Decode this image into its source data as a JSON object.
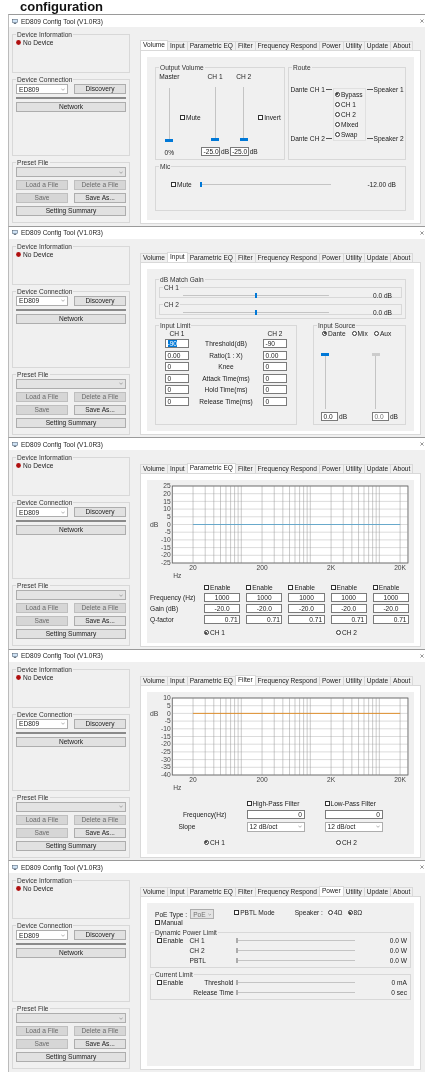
{
  "heading": "configuration",
  "windows": [
    {
      "title": "ED809 Config Tool (V1.0R3)",
      "sidebar": {
        "info_title": "Device Information",
        "status": "No Device",
        "connection_title": "Device Connection",
        "device": "ED809",
        "discovery": "Discovery",
        "network": "Network",
        "preset_title": "Preset File",
        "file_buttons": [
          {
            "label": "Load a File",
            "disabled": true
          },
          {
            "label": "Delete a File",
            "disabled": true
          },
          {
            "label": "Save",
            "disabled": true
          },
          {
            "label": "Save As...",
            "disabled": false
          }
        ],
        "summary": "Setting Summary"
      },
      "tabs": [
        {
          "label": "Volume",
          "selected": true
        },
        {
          "label": "Input",
          "selected": false
        },
        {
          "label": "Parametric EQ",
          "selected": false
        },
        {
          "label": "Filter",
          "selected": false
        },
        {
          "label": "Frequency Respond",
          "selected": false
        },
        {
          "label": "Power",
          "selected": false
        },
        {
          "label": "Utility",
          "selected": false
        },
        {
          "label": "Update",
          "selected": false
        },
        {
          "label": "About",
          "selected": false
        }
      ],
      "content": {
        "kind": "volume",
        "output_title": "Output Volume",
        "columns": [
          {
            "label": "Master",
            "level": 0,
            "reading": "0%"
          },
          {
            "label": "CH 1",
            "level": 0,
            "value": "-25.0",
            "unit": "dB"
          },
          {
            "label": "CH 2",
            "level": 0,
            "value": "-25.0",
            "unit": "dB"
          }
        ],
        "mute": {
          "label": "Mute",
          "checked": false
        },
        "invert": {
          "label": "Invert",
          "checked": false
        },
        "route_title": "Route",
        "route_inputs": [
          "Dante CH 1",
          "Dante CH 2"
        ],
        "route_outputs": [
          "Speaker 1",
          "Speaker 2"
        ],
        "route_options": [
          {
            "label": "Bypass",
            "selected": true
          },
          {
            "label": "CH 1",
            "selected": false
          },
          {
            "label": "CH 2",
            "selected": false
          },
          {
            "label": "Mixed",
            "selected": false
          },
          {
            "label": "Swap",
            "selected": false
          }
        ],
        "mic_title": "Mic",
        "mic_mute": {
          "label": "Mute",
          "checked": false
        },
        "mic_slider": {
          "level": 0
        },
        "mic_reading": "-12.00 dB"
      }
    },
    {
      "title": "ED809 Config Tool (V1.0R3)",
      "sidebar": {
        "info_title": "Device Information",
        "status": "No Device",
        "connection_title": "Device Connection",
        "device": "ED809",
        "discovery": "Discovery",
        "network": "Network",
        "preset_title": "Preset File",
        "file_buttons": [
          {
            "label": "Load a File",
            "disabled": true
          },
          {
            "label": "Delete a File",
            "disabled": true
          },
          {
            "label": "Save",
            "disabled": true
          },
          {
            "label": "Save As...",
            "disabled": false
          }
        ],
        "summary": "Setting Summary"
      },
      "tabs": [
        {
          "label": "Volume",
          "selected": false
        },
        {
          "label": "Input",
          "selected": true
        },
        {
          "label": "Parametric EQ",
          "selected": false
        },
        {
          "label": "Filter",
          "selected": false
        },
        {
          "label": "Frequency Respond",
          "selected": false
        },
        {
          "label": "Power",
          "selected": false
        },
        {
          "label": "Utility",
          "selected": false
        },
        {
          "label": "Update",
          "selected": false
        },
        {
          "label": "About",
          "selected": false
        }
      ],
      "content": {
        "kind": "input",
        "gain_title": "dB Match Gain",
        "gains": [
          {
            "label": "CH 1",
            "level": 0.5,
            "reading": "0.0 dB"
          },
          {
            "label": "CH 2",
            "level": 0.5,
            "reading": "0.0 dB"
          }
        ],
        "limit_title": "Input Limit",
        "limit_headers": [
          "CH 1",
          "CH 2"
        ],
        "limit_rows": [
          {
            "ch1": "-90",
            "highlighted": true,
            "label": "Threshold(dB)",
            "ch2": "-90"
          },
          {
            "ch1": "0.00",
            "highlighted": false,
            "label": "Ratio(1 : X)",
            "ch2": "0.00"
          },
          {
            "ch1": "0",
            "highlighted": false,
            "label": "Knee",
            "ch2": "0"
          },
          {
            "ch1": "0",
            "highlighted": false,
            "label": "Attack Time(ms)",
            "ch2": "0"
          },
          {
            "ch1": "0",
            "highlighted": false,
            "label": "Hold Time(ms)",
            "ch2": "0"
          },
          {
            "ch1": "0",
            "highlighted": false,
            "label": "Release Time(ms)",
            "ch2": "0"
          }
        ],
        "source_title": "Input Source",
        "sources": [
          {
            "label": "Dante",
            "selected": true
          },
          {
            "label": "Mix",
            "selected": false
          },
          {
            "label": "Aux",
            "selected": false
          }
        ],
        "source_sliders": [
          {
            "level": 1,
            "value": "0.0",
            "unit": "dB",
            "disabled": false
          },
          {
            "level": 1,
            "value": "0.0",
            "unit": "dB",
            "disabled": true
          }
        ]
      }
    },
    {
      "title": "ED809 Config Tool (V1.0R3)",
      "sidebar": {
        "info_title": "Device Information",
        "status": "No Device",
        "connection_title": "Device Connection",
        "device": "ED809",
        "discovery": "Discovery",
        "network": "Network",
        "preset_title": "Preset File",
        "file_buttons": [
          {
            "label": "Load a File",
            "disabled": true
          },
          {
            "label": "Delete a File",
            "disabled": true
          },
          {
            "label": "Save",
            "disabled": true
          },
          {
            "label": "Save As...",
            "disabled": false
          }
        ],
        "summary": "Setting Summary"
      },
      "tabs": [
        {
          "label": "Volume",
          "selected": false
        },
        {
          "label": "Input",
          "selected": false
        },
        {
          "label": "Parametric EQ",
          "selected": true
        },
        {
          "label": "Filter",
          "selected": false
        },
        {
          "label": "Frequency Respond",
          "selected": false
        },
        {
          "label": "Power",
          "selected": false
        },
        {
          "label": "Utility",
          "selected": false
        },
        {
          "label": "Update",
          "selected": false
        },
        {
          "label": "About",
          "selected": false
        }
      ],
      "content": {
        "kind": "eq",
        "chart_data": {
          "type": "line",
          "xlabel": "Hz",
          "ylabel": "dB",
          "categories": [
            "20",
            "200",
            "2K",
            "20K"
          ],
          "series": [
            {
              "color": "#5ba3c9",
              "values": [
                0,
                0,
                0,
                0
              ]
            }
          ],
          "grid": true,
          "ylim": [
            -25,
            25
          ],
          "yticks": [
            25,
            20,
            15,
            10,
            5,
            0,
            -5,
            -10,
            -15,
            -20,
            -25
          ]
        },
        "row_labels": [
          "Frequency (Hz)",
          "Gain (dB)",
          "Q-factor"
        ],
        "bands": [
          {
            "enable": "Enable",
            "checked": false,
            "frequency": "1000",
            "gain": "-20.0",
            "q": "0.71"
          },
          {
            "enable": "Enable",
            "checked": false,
            "frequency": "1000",
            "gain": "-20.0",
            "q": "0.71"
          },
          {
            "enable": "Enable",
            "checked": false,
            "frequency": "1000",
            "gain": "-20.0",
            "q": "0.71"
          },
          {
            "enable": "Enable",
            "checked": false,
            "frequency": "1000",
            "gain": "-20.0",
            "q": "0.71"
          },
          {
            "enable": "Enable",
            "checked": false,
            "frequency": "1000",
            "gain": "-20.0",
            "q": "0.71"
          }
        ],
        "channels": [
          {
            "label": "CH 1",
            "selected": true
          },
          {
            "label": "CH 2",
            "selected": false
          }
        ]
      }
    },
    {
      "title": "ED809 Config Tool (V1.0R3)",
      "sidebar": {
        "info_title": "Device Information",
        "status": "No Device",
        "connection_title": "Device Connection",
        "device": "ED809",
        "discovery": "Discovery",
        "network": "Network",
        "preset_title": "Preset File",
        "file_buttons": [
          {
            "label": "Load a File",
            "disabled": true
          },
          {
            "label": "Delete a File",
            "disabled": true
          },
          {
            "label": "Save",
            "disabled": true
          },
          {
            "label": "Save As...",
            "disabled": false
          }
        ],
        "summary": "Setting Summary"
      },
      "tabs": [
        {
          "label": "Volume",
          "selected": false
        },
        {
          "label": "Input",
          "selected": false
        },
        {
          "label": "Parametric EQ",
          "selected": false
        },
        {
          "label": "Filter",
          "selected": true
        },
        {
          "label": "Frequency Respond",
          "selected": false
        },
        {
          "label": "Power",
          "selected": false
        },
        {
          "label": "Utility",
          "selected": false
        },
        {
          "label": "Update",
          "selected": false
        },
        {
          "label": "About",
          "selected": false
        }
      ],
      "content": {
        "kind": "filter",
        "chart_data": {
          "type": "line",
          "xlabel": "Hz",
          "ylabel": "dB",
          "categories": [
            "20",
            "200",
            "2K",
            "20K"
          ],
          "series": [
            {
              "color": "#e08a1e",
              "values": [
                0,
                0,
                0,
                0
              ]
            }
          ],
          "grid": true,
          "ylim": [
            -40,
            10
          ],
          "yticks": [
            10,
            5,
            0,
            -5,
            -10,
            -15,
            -20,
            -25,
            -30,
            -35,
            -40
          ]
        },
        "frequency_label": "Frequency(Hz)",
        "slope_label": "Slope",
        "filters": [
          {
            "label": "High-Pass Filter",
            "checked": false,
            "frequency": "0",
            "slope": "12 dB/oct"
          },
          {
            "label": "Low-Pass Filter",
            "checked": false,
            "frequency": "0",
            "slope": "12 dB/oct"
          }
        ],
        "channels": [
          {
            "label": "CH 1",
            "selected": true
          },
          {
            "label": "CH 2",
            "selected": false
          }
        ]
      }
    },
    {
      "title": "ED809 Config Tool (V1.0R3)",
      "sidebar": {
        "info_title": "Device Information",
        "status": "No Device",
        "connection_title": "Device Connection",
        "device": "ED809",
        "discovery": "Discovery",
        "network": "Network",
        "preset_title": "Preset File",
        "file_buttons": [
          {
            "label": "Load a File",
            "disabled": true
          },
          {
            "label": "Delete a File",
            "disabled": true
          },
          {
            "label": "Save",
            "disabled": true
          },
          {
            "label": "Save As...",
            "disabled": false
          }
        ],
        "summary": "Setting Summary"
      },
      "tabs": [
        {
          "label": "Volume",
          "selected": false
        },
        {
          "label": "Input",
          "selected": false
        },
        {
          "label": "Parametric EQ",
          "selected": false
        },
        {
          "label": "Filter",
          "selected": false
        },
        {
          "label": "Frequency Respond",
          "selected": false
        },
        {
          "label": "Power",
          "selected": true
        },
        {
          "label": "Utility",
          "selected": false
        },
        {
          "label": "Update",
          "selected": false
        },
        {
          "label": "About",
          "selected": false
        }
      ],
      "content": {
        "kind": "power",
        "poe_label": "PoE Type :",
        "poe_value": "PoE",
        "poe_disabled": true,
        "manual": {
          "label": "Manual",
          "checked": false
        },
        "pbtl": {
          "label": "PBTL Mode",
          "checked": false
        },
        "speaker_label": "Speaker :",
        "speakers": [
          {
            "label": "4Ω",
            "selected": false
          },
          {
            "label": "8Ω",
            "selected": true
          }
        ],
        "dynamic_title": "Dynamic Power Limit",
        "dynamic_enable": {
          "label": "Enable",
          "checked": false
        },
        "dynamic_rows": [
          {
            "label": "CH 1",
            "level": 0,
            "reading": "0.0 W"
          },
          {
            "label": "CH 2",
            "level": 0,
            "reading": "0.0 W"
          },
          {
            "label": "PBTL",
            "level": 0,
            "reading": "0.0 W"
          }
        ],
        "current_title": "Current Limit",
        "current_enable": {
          "label": "Enable",
          "checked": false
        },
        "current_rows": [
          {
            "label": "Threshold",
            "level": 0,
            "reading": "0 mA"
          },
          {
            "label": "Release Time",
            "level": 0,
            "reading": "0 sec"
          }
        ]
      }
    }
  ]
}
